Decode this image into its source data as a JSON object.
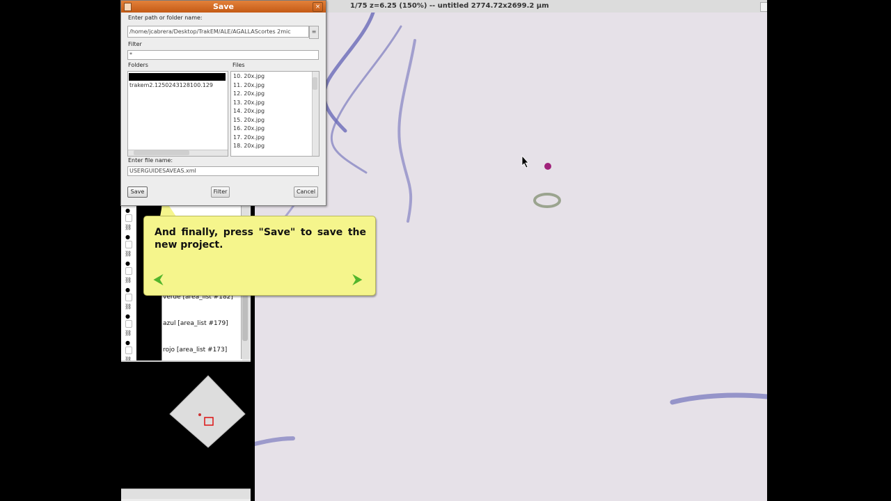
{
  "image_window": {
    "title": "1/75  z=6.25  (150%) -- untitled   2774.72x2699.2 µm"
  },
  "save_dialog": {
    "title": "Save",
    "path_label": "Enter path or folder name:",
    "path_value": "/home/jcabrera/Desktop/TrakEM/ALE/AGALLAScortes 2mic",
    "filter_label": "Filter",
    "filter_value": "*",
    "folders_label": "Folders",
    "files_label": "Files",
    "folders": [
      "trakem2.1250243128100.129"
    ],
    "files": [
      "10. 20x.jpg",
      "11. 20x.jpg",
      "12. 20x.jpg",
      "13. 20x.jpg",
      "14. 20x.jpg",
      "15. 20x.jpg",
      "16. 20x.jpg",
      "17. 20x.jpg",
      "18. 20x.jpg"
    ],
    "filename_label": "Enter file name:",
    "filename_value": "USERGUIDESAVEAS.xml",
    "save_button": "Save",
    "filter_button": "Filter",
    "cancel_button": "Cancel"
  },
  "layers": [
    {
      "label": ""
    },
    {
      "label": ""
    },
    {
      "label": ""
    },
    {
      "label": "verde [area_list #182]"
    },
    {
      "label": "azul [area_list #179]"
    },
    {
      "label": "rojo [area_list #173]"
    }
  ],
  "tooltip": {
    "text": "And finally, press \"Save\" to save the new project.",
    "prev": "⮜",
    "next": "⮞"
  }
}
